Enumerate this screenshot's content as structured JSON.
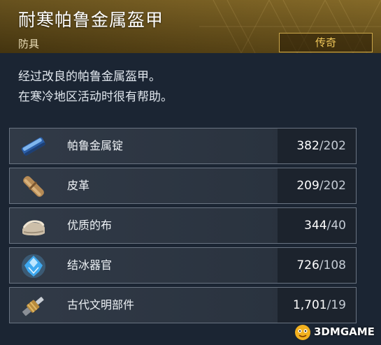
{
  "item": {
    "name": "耐寒帕鲁金属盔甲",
    "category": "防具",
    "rarity": "传奇",
    "description_lines": [
      "经过改良的帕鲁金属盔甲。",
      "在寒冷地区活动时很有帮助。"
    ]
  },
  "materials": [
    {
      "name": "帕鲁金属锭",
      "have": "382",
      "sep": "/",
      "need": "202",
      "icon": "pal-metal-ingot-icon"
    },
    {
      "name": "皮革",
      "have": "209",
      "sep": "/",
      "need": "202",
      "icon": "leather-roll-icon"
    },
    {
      "name": "优质的布",
      "have": "344",
      "sep": "/",
      "need": "40",
      "icon": "high-quality-cloth-icon"
    },
    {
      "name": "结冰器官",
      "have": "726",
      "sep": "/",
      "need": "108",
      "icon": "frozen-organ-icon"
    },
    {
      "name": "古代文明部件",
      "have": "1,701",
      "sep": "/",
      "need": "19",
      "icon": "ancient-civilization-part-icon"
    }
  ],
  "watermark": {
    "text": "3DMGAME"
  },
  "colors": {
    "rarity_gold": "#f1c85a",
    "header_gold": "#6b5219",
    "row_bg": "#313a47"
  }
}
